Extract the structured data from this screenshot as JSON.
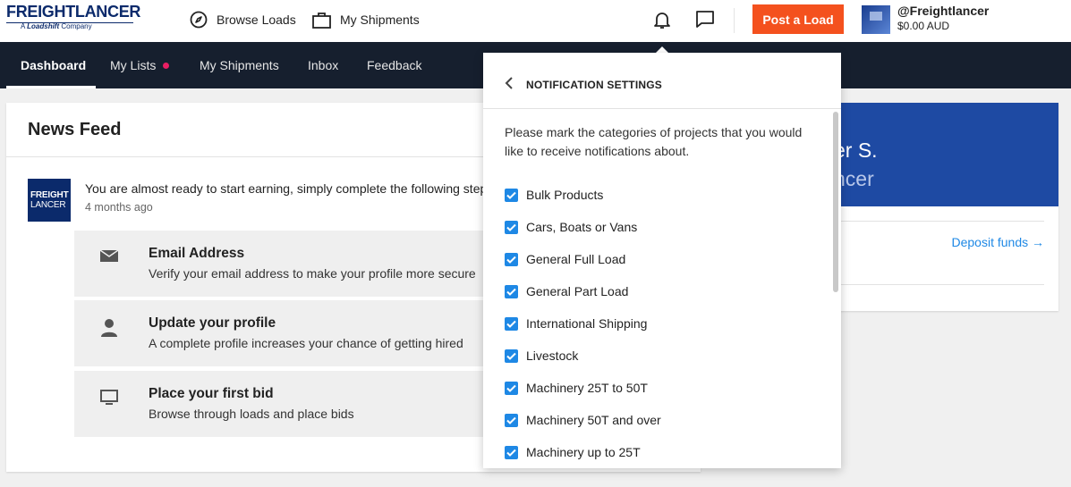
{
  "brand": {
    "logo_main_a": "FREIGHT",
    "logo_main_b": "LANCER",
    "logo_sub_a": "A",
    "logo_sub_b": "Loadshift",
    "logo_sub_c": "Company"
  },
  "topbar": {
    "browse_loads": "Browse Loads",
    "my_shipments": "My Shipments",
    "post_load": "Post a Load",
    "username": "@Freightlancer",
    "balance": "$0.00 AUD"
  },
  "nav": {
    "items": [
      {
        "label": "Dashboard"
      },
      {
        "label": "My Lists"
      },
      {
        "label": "My Shipments"
      },
      {
        "label": "Inbox"
      },
      {
        "label": "Feedback"
      }
    ]
  },
  "news": {
    "title": "News Feed",
    "logo_a": "FREIGHT",
    "logo_b": "LANCER",
    "message": "You are almost ready to start earning, simply complete the following steps",
    "time": "4 months ago",
    "tasks": [
      {
        "title": "Email Address",
        "desc": "Verify your email address to make your profile more secure",
        "icon": "envelope-icon"
      },
      {
        "title": "Update your profile",
        "desc": "A complete profile increases your chance of getting hired",
        "icon": "person-icon"
      },
      {
        "title": "Place your first bid",
        "desc": "Browse through loads and place bids",
        "icon": "monitor-icon"
      }
    ]
  },
  "profile": {
    "name": "er S.",
    "role": "ncer",
    "deposit": "Deposit funds →"
  },
  "notifications": {
    "title": "NOTIFICATION SETTINGS",
    "intro": "Please mark the categories of projects that you would like to receive notifications about.",
    "categories": [
      {
        "label": "Bulk Products",
        "checked": true
      },
      {
        "label": "Cars, Boats or Vans",
        "checked": true
      },
      {
        "label": "General Full Load",
        "checked": true
      },
      {
        "label": "General Part Load",
        "checked": true
      },
      {
        "label": "International Shipping",
        "checked": true
      },
      {
        "label": "Livestock",
        "checked": true
      },
      {
        "label": "Machinery 25T to 50T",
        "checked": true
      },
      {
        "label": "Machinery 50T and over",
        "checked": true
      },
      {
        "label": "Machinery up to 25T",
        "checked": true
      }
    ]
  },
  "colors": {
    "accent": "#1e88e5",
    "post_button": "#f4511e",
    "nav_bg": "#161f2e",
    "brand_blue": "#0b2a6b",
    "profile_banner": "#1e4aa3"
  }
}
